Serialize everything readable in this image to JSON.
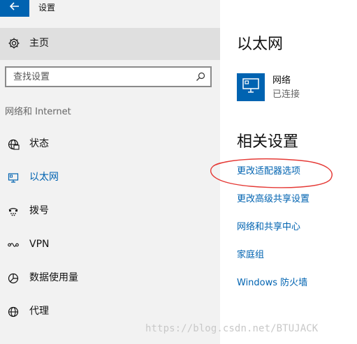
{
  "window": {
    "title": "设置"
  },
  "sidebar": {
    "home_label": "主页",
    "search": {
      "placeholder": "查找设置"
    },
    "section_label": "网络和 Internet",
    "items": [
      {
        "label": "状态",
        "icon": "globe-status-icon",
        "active": false
      },
      {
        "label": "以太网",
        "icon": "ethernet-icon",
        "active": true
      },
      {
        "label": "拨号",
        "icon": "dial-up-icon",
        "active": false
      },
      {
        "label": "VPN",
        "icon": "vpn-icon",
        "active": false
      },
      {
        "label": "数据使用量",
        "icon": "data-usage-icon",
        "active": false
      },
      {
        "label": "代理",
        "icon": "proxy-globe-icon",
        "active": false
      }
    ]
  },
  "main": {
    "page_title": "以太网",
    "network": {
      "name": "网络",
      "status": "已连接"
    },
    "related_settings_title": "相关设置",
    "related_links": [
      "更改适配器选项",
      "更改高级共享设置",
      "网络和共享中心",
      "家庭组",
      "Windows 防火墙"
    ]
  },
  "watermark": "https://blog.csdn.net/BTUJACK",
  "colors": {
    "accent": "#0063b1",
    "annotation": "#e53935",
    "sidebar_bg": "#f2f2f2",
    "selected_bg": "#dfdfdf"
  }
}
